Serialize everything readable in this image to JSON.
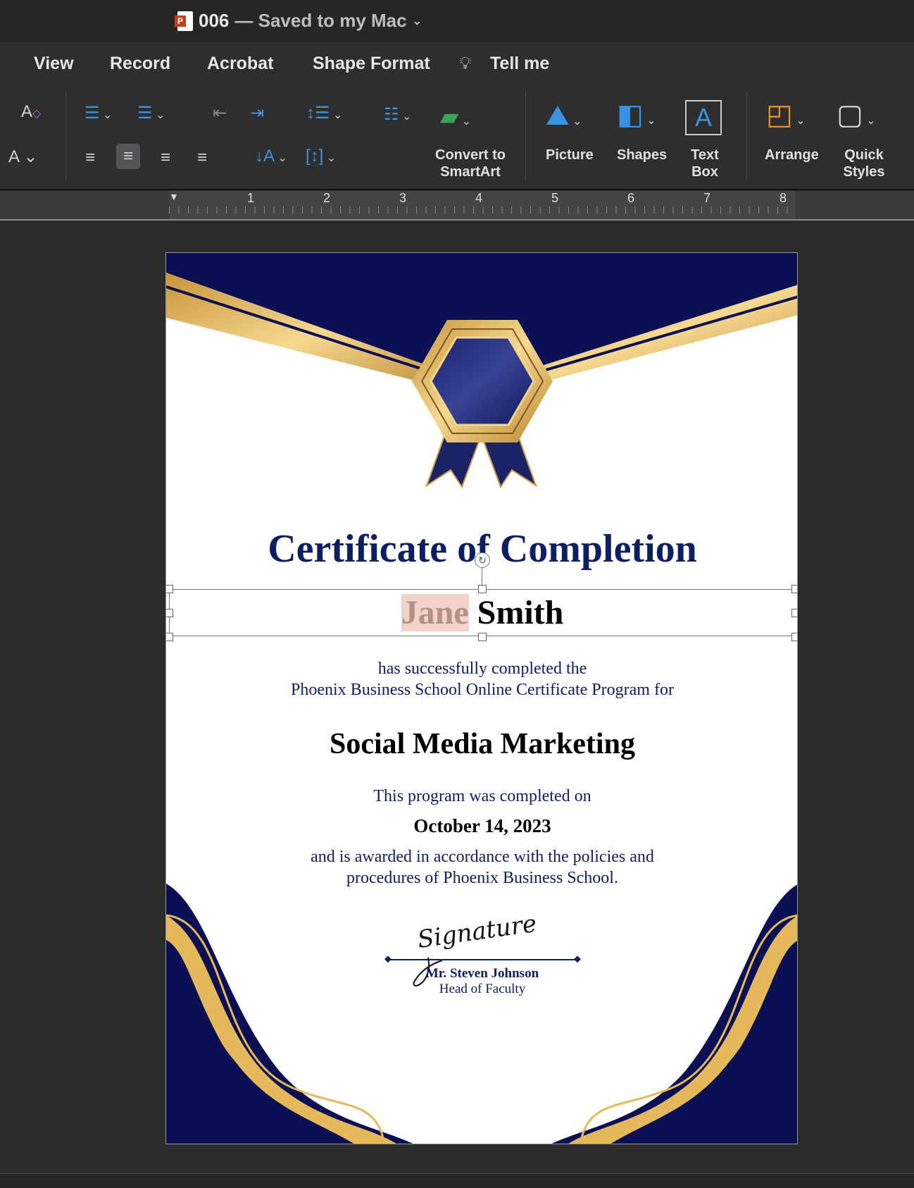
{
  "window": {
    "doc_name": "006",
    "save_status": "— Saved to my Mac"
  },
  "menu": [
    "View",
    "Record",
    "Acrobat",
    "Shape Format",
    "Tell me"
  ],
  "ribbon": {
    "convert": "Convert to SmartArt",
    "picture": "Picture",
    "shapes": "Shapes",
    "textbox": "Text Box",
    "arrange": "Arrange",
    "quick_styles": "Quick Styles"
  },
  "ruler": [
    "1",
    "2",
    "3",
    "4",
    "5",
    "6",
    "7",
    "8"
  ],
  "certificate": {
    "title": "Certificate of Completion",
    "first_name": "Jane",
    "last_name": "Smith",
    "line1": "has successfully completed the",
    "line2": "Phoenix Business School Online Certificate Program for",
    "course": "Social Media Marketing",
    "completed_on": "This program was completed on",
    "date": "October 14, 2023",
    "line3": "and is awarded in accordance with the policies and",
    "line4": "procedures of Phoenix Business School.",
    "signature": "Signature",
    "signer": "Mr. Steven Johnson",
    "signer_title": "Head of Faculty"
  },
  "colors": {
    "navy": "#0b1054",
    "gold": "#e6b85c",
    "title": "#0d1f63",
    "highlight": "#f2d3cc"
  }
}
